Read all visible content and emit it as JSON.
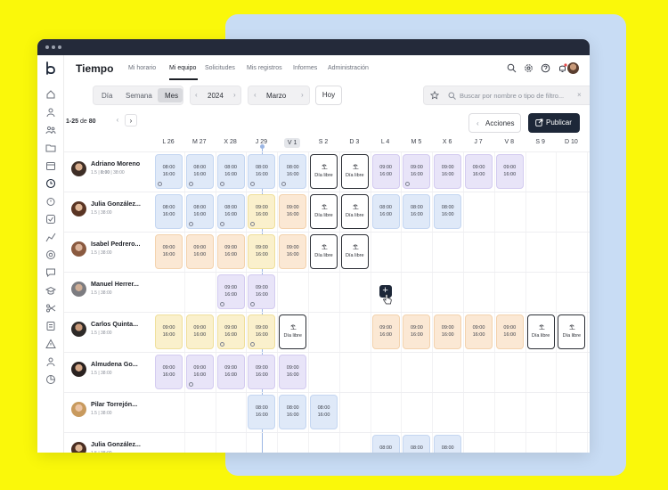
{
  "app": {
    "title": "Tiempo"
  },
  "nav": [
    "Mi horario",
    "Mi equipo",
    "Solicitudes",
    "Mis registros",
    "Informes",
    "Administración"
  ],
  "view": {
    "segments": [
      "Día",
      "Semana",
      "Mes"
    ],
    "active": "Mes",
    "year": "2024",
    "month": "Marzo",
    "today_label": "Hoy"
  },
  "search": {
    "placeholder": "Buscar por nombre o tipo de filtro..."
  },
  "pagination": {
    "range": "1-25",
    "of": "de",
    "total": "80"
  },
  "actions": {
    "acciones": "Acciones",
    "publicar": "Publicar"
  },
  "days": [
    "L 26",
    "M 27",
    "X 28",
    "J 29",
    "V 1",
    "S 2",
    "D 3",
    "L 4",
    "M 5",
    "X 6",
    "J 7",
    "V 8",
    "S 9",
    "D 10"
  ],
  "today_index": 4,
  "employees": [
    {
      "name": "Adriano Moreno",
      "meta_a": "1.5 |",
      "meta_b": "8:00",
      "meta_c": "| 38:00"
    },
    {
      "name": "Julia González...",
      "meta_a": "1.5 | 38:00"
    },
    {
      "name": "Isabel Pedrero...",
      "meta_a": "1.5 | 38:00"
    },
    {
      "name": "Manuel Herrer...",
      "meta_a": "1.5 | 38:00"
    },
    {
      "name": "Carlos Quinta...",
      "meta_a": "1.5 | 38:00"
    },
    {
      "name": "Almudena Go...",
      "meta_a": "1.5 | 38:00"
    },
    {
      "name": "Pilar Torrejón...",
      "meta_a": "1.5 | 38:00"
    },
    {
      "name": "Julia González...",
      "meta_a": "1.5 | 38:00"
    }
  ],
  "shift_label": {
    "start": "09:00",
    "end": "16:00",
    "start_alt": "08:00",
    "free": "Día libre"
  },
  "schedule": [
    [
      "blue|08:00|16:00|i",
      "blue|08:00|16:00|i",
      "blue|08:00|16:00|i",
      "blue|08:00|16:00|i",
      "blue|08:00|16:00|i",
      "free",
      "free",
      "purple|09:00|16:00",
      "purple|09:00|16:00|i",
      "purple|09:00|16:00",
      "purple|09:00|16:00",
      "purple|09:00|16:00",
      "",
      ""
    ],
    [
      "blue|08:00|16:00",
      "blue|08:00|16:00|i",
      "blue|08:00|16:00|i",
      "yellow|09:00|16:00|i",
      "orange|09:00|16:00",
      "free",
      "free",
      "blue|08:00|16:00",
      "blue|08:00|16:00",
      "blue|08:00|16:00",
      "",
      "",
      "",
      ""
    ],
    [
      "orange|09:00|16:00",
      "orange|09:00|16:00",
      "orange|09:00|16:00",
      "yellow|09:00|16:00",
      "orange|09:00|16:00",
      "free",
      "free",
      "",
      "",
      "",
      "",
      "",
      "",
      ""
    ],
    [
      "",
      "",
      "purple|09:00|16:00|i",
      "purple|09:00|16:00|i",
      "",
      "",
      "",
      "",
      "",
      "",
      "",
      "",
      "",
      ""
    ],
    [
      "yellow|09:00|16:00",
      "yellow|09:00|16:00",
      "yellow|09:00|16:00|i",
      "yellow|09:00|16:00|i",
      "free",
      "",
      "",
      "orange|09:00|16:00",
      "orange|09:00|16:00",
      "orange|09:00|16:00",
      "orange|09:00|16:00",
      "orange|09:00|16:00",
      "free",
      "free"
    ],
    [
      "purple|09:00|16:00",
      "purple|09:00|16:00|i",
      "purple|09:00|16:00",
      "purple|09:00|16:00",
      "purple|09:00|16:00",
      "",
      "",
      "",
      "",
      "",
      "",
      "",
      "",
      ""
    ],
    [
      "",
      "",
      "",
      "blue|08:00|16:00",
      "blue|08:00|16:00",
      "blue|08:00|16:00",
      "",
      "",
      "",
      "",
      "",
      "",
      "",
      ""
    ],
    [
      "",
      "",
      "",
      "",
      "",
      "",
      "",
      "blue|08:00|",
      "blue|08:00|",
      "blue|08:00|",
      "",
      "",
      "",
      ""
    ]
  ],
  "colors": {
    "accent": "#1d2738",
    "page_bg": "#faf80a",
    "card_bg": "#c8dcf4"
  }
}
